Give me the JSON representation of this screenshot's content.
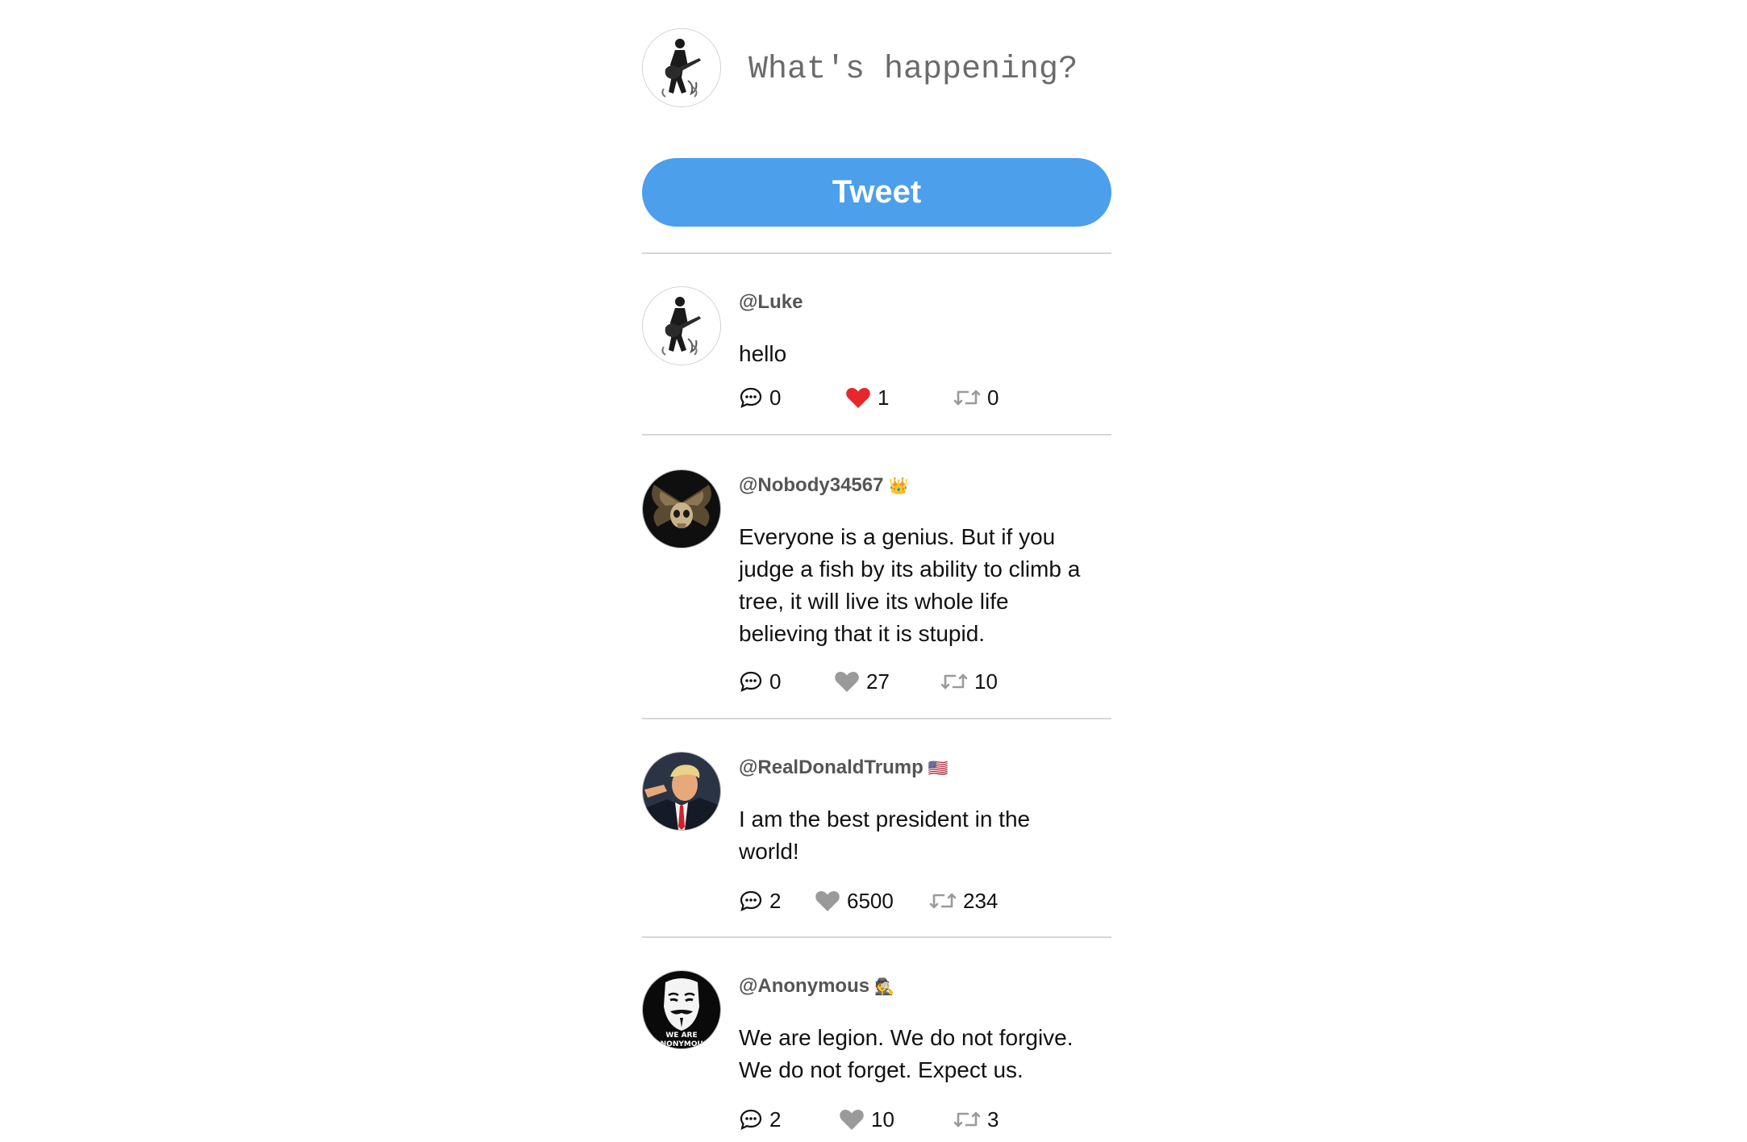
{
  "composer": {
    "placeholder": "What's happening?",
    "button_label": "Tweet"
  },
  "posts": [
    {
      "handle": "@Luke",
      "badge": "",
      "text": "hello",
      "comments": "0",
      "likes": "1",
      "liked": true,
      "retweets": "0"
    },
    {
      "handle": "@Nobody34567",
      "badge": "👑",
      "text": "Everyone is a genius. But if you judge a fish by its ability to climb a tree, it will live its whole life believing that it is stupid.",
      "comments": "0",
      "likes": "27",
      "liked": false,
      "retweets": "10"
    },
    {
      "handle": "@RealDonaldTrump",
      "badge": "🇺🇸",
      "text": "I am the best president in the world!",
      "comments": "2",
      "likes": "6500",
      "liked": false,
      "retweets": "234"
    },
    {
      "handle": "@Anonymous",
      "badge": "🕵",
      "text": "We are legion. We do not forgive. We do not forget. Expect us.",
      "comments": "2",
      "likes": "10",
      "liked": false,
      "retweets": "3"
    }
  ],
  "colors": {
    "accent": "#4c9fea",
    "like_active": "#e8262b",
    "like_inactive": "#9a9a9a",
    "divider": "#d6d6d6"
  },
  "avatar_text": {
    "anonymous_line1": "WE ARE",
    "anonymous_line2": "ANONYMOUS"
  }
}
